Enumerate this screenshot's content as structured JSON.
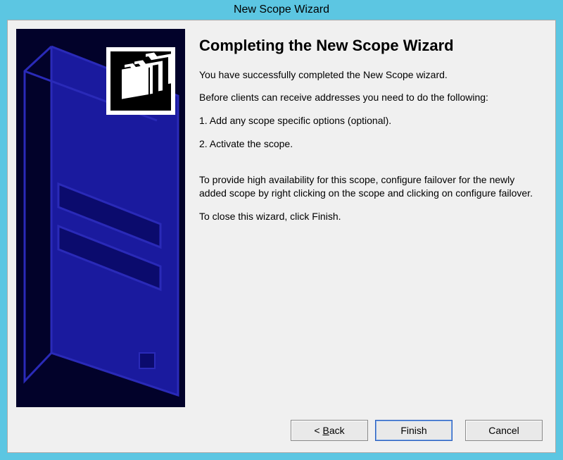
{
  "window": {
    "title": "New Scope Wizard"
  },
  "page": {
    "heading": "Completing the New Scope Wizard",
    "intro": "You have successfully completed the New Scope wizard.",
    "before_text": "Before clients can receive addresses you need to do the following:",
    "step1": "1. Add any scope specific options (optional).",
    "step2": "2. Activate the scope.",
    "ha_text": "To provide high availability for this scope, configure failover for the newly added scope by right clicking on the scope and clicking on configure failover.",
    "close_text": "To close this wizard, click Finish."
  },
  "buttons": {
    "back_prefix": "< ",
    "back_mn": "B",
    "back_suffix": "ack",
    "finish": "Finish",
    "cancel": "Cancel"
  }
}
